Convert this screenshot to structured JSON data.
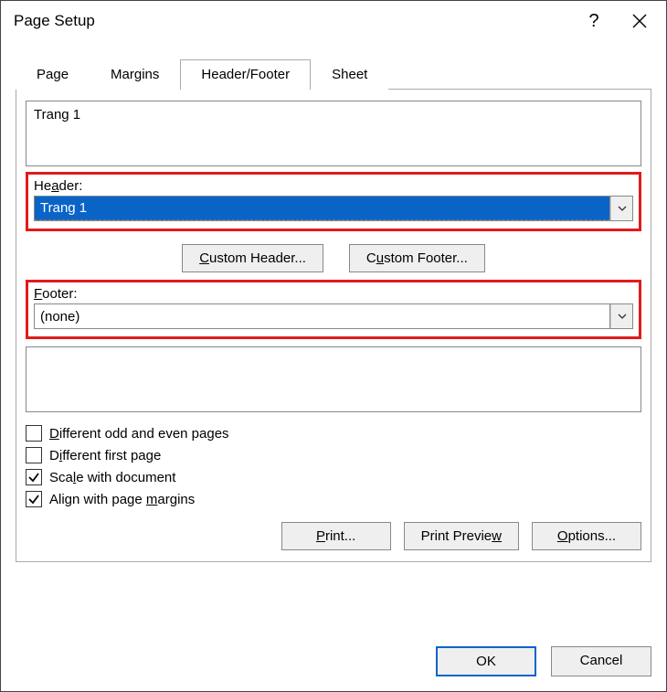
{
  "title": "Page Setup",
  "help_label": "?",
  "tabs": {
    "page": "Page",
    "margins": "Margins",
    "headerfooter": "Header/Footer",
    "sheet": "Sheet"
  },
  "header_preview": "Trang 1",
  "header_label_pre": "He",
  "header_label_u": "a",
  "header_label_post": "der:",
  "header_value": "Trang 1",
  "custom_header_pre": "",
  "custom_header_u": "C",
  "custom_header_post": "ustom Header...",
  "custom_footer_pre": "C",
  "custom_footer_u": "u",
  "custom_footer_post": "stom Footer...",
  "footer_label_u": "F",
  "footer_label_post": "ooter:",
  "footer_value": "(none)",
  "footer_preview": "",
  "chk_diff_odd_u": "D",
  "chk_diff_odd_post": "ifferent odd and even pages",
  "chk_diff_first_pre": "D",
  "chk_diff_first_u": "i",
  "chk_diff_first_post": "fferent first page",
  "chk_scale_pre": "Sca",
  "chk_scale_u": "l",
  "chk_scale_post": "e with document",
  "chk_align_pre": "Align with page ",
  "chk_align_u": "m",
  "chk_align_post": "argins",
  "print_u": "P",
  "print_post": "rint...",
  "preview_pre": "Print Previe",
  "preview_u": "w",
  "options_u": "O",
  "options_post": "ptions...",
  "ok": "OK",
  "cancel": "Cancel"
}
